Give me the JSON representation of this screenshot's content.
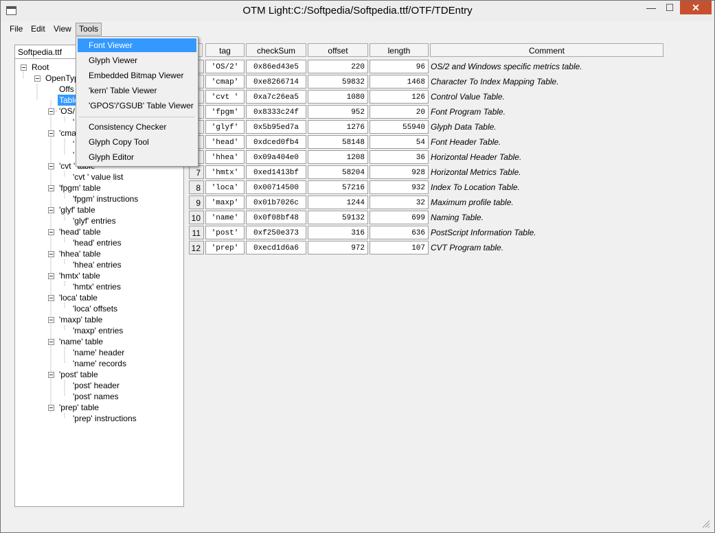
{
  "window": {
    "title": "OTM Light:C:/Softpedia/Softpedia.ttf/OTF/TDEntry",
    "min": "—",
    "max": "☐",
    "close": "✕"
  },
  "menubar": {
    "file": "File",
    "edit": "Edit",
    "view": "View",
    "tools": "Tools"
  },
  "tools_menu": {
    "items": [
      "Font Viewer",
      "Glyph Viewer",
      "Embedded Bitmap Viewer",
      "'kern' Table Viewer",
      "'GPOS'/'GSUB' Table Viewer",
      "Consistency Checker",
      "Glyph Copy Tool",
      "Glyph Editor"
    ]
  },
  "tree": {
    "header": "Softpedia.ttf",
    "nodes": [
      "Root",
      "OpenTyp",
      "Offs",
      "Table",
      "'OS/",
      "'",
      "'cma",
      "'",
      "'",
      "'cvt ' table",
      "'cvt ' value list",
      "'fpgm' table",
      "'fpgm' instructions",
      "'glyf' table",
      "'glyf' entries",
      "'head' table",
      "'head' entries",
      "'hhea' table",
      "'hhea' entries",
      "'hmtx' table",
      "'hmtx' entries",
      "'loca' table",
      "'loca' offsets",
      "'maxp' table",
      "'maxp' entries",
      "'name' table",
      "'name' header",
      "'name' records",
      "'post' table",
      "'post' header",
      "'post' names",
      "'prep' table",
      "'prep' instructions"
    ]
  },
  "table": {
    "columns": [
      "tag",
      "checkSum",
      "offset",
      "length",
      "Comment"
    ],
    "rows": [
      {
        "n": "",
        "tag": "'OS/2'",
        "checksum": "0x86ed43e5",
        "offset": "220",
        "length": "96",
        "comment": "OS/2 and Windows specific metrics table."
      },
      {
        "n": "",
        "tag": "'cmap'",
        "checksum": "0xe8266714",
        "offset": "59832",
        "length": "1468",
        "comment": "Character To Index Mapping Table."
      },
      {
        "n": "",
        "tag": "'cvt '",
        "checksum": "0xa7c26ea5",
        "offset": "1080",
        "length": "126",
        "comment": "Control Value Table."
      },
      {
        "n": "",
        "tag": "'fpgm'",
        "checksum": "0x8333c24f",
        "offset": "952",
        "length": "20",
        "comment": "Font Program Table."
      },
      {
        "n": "",
        "tag": "'glyf'",
        "checksum": "0x5b95ed7a",
        "offset": "1276",
        "length": "55940",
        "comment": "Glyph Data Table."
      },
      {
        "n": "",
        "tag": "'head'",
        "checksum": "0xdced0fb4",
        "offset": "58148",
        "length": "54",
        "comment": "Font Header Table."
      },
      {
        "n": "",
        "tag": "'hhea'",
        "checksum": "0x09a404e0",
        "offset": "1208",
        "length": "36",
        "comment": "Horizontal Header Table."
      },
      {
        "n": "7",
        "tag": "'hmtx'",
        "checksum": "0xed1413bf",
        "offset": "58204",
        "length": "928",
        "comment": "Horizontal Metrics Table."
      },
      {
        "n": "8",
        "tag": "'loca'",
        "checksum": "0x00714500",
        "offset": "57216",
        "length": "932",
        "comment": "Index To Location Table."
      },
      {
        "n": "9",
        "tag": "'maxp'",
        "checksum": "0x01b7026c",
        "offset": "1244",
        "length": "32",
        "comment": "Maximum profile table."
      },
      {
        "n": "10",
        "tag": "'name'",
        "checksum": "0x0f08bf48",
        "offset": "59132",
        "length": "699",
        "comment": "Naming Table."
      },
      {
        "n": "11",
        "tag": "'post'",
        "checksum": "0xf250e373",
        "offset": "316",
        "length": "636",
        "comment": "PostScript Information Table."
      },
      {
        "n": "12",
        "tag": "'prep'",
        "checksum": "0xecd1d6a6",
        "offset": "972",
        "length": "107",
        "comment": "CVT Program table."
      }
    ]
  }
}
